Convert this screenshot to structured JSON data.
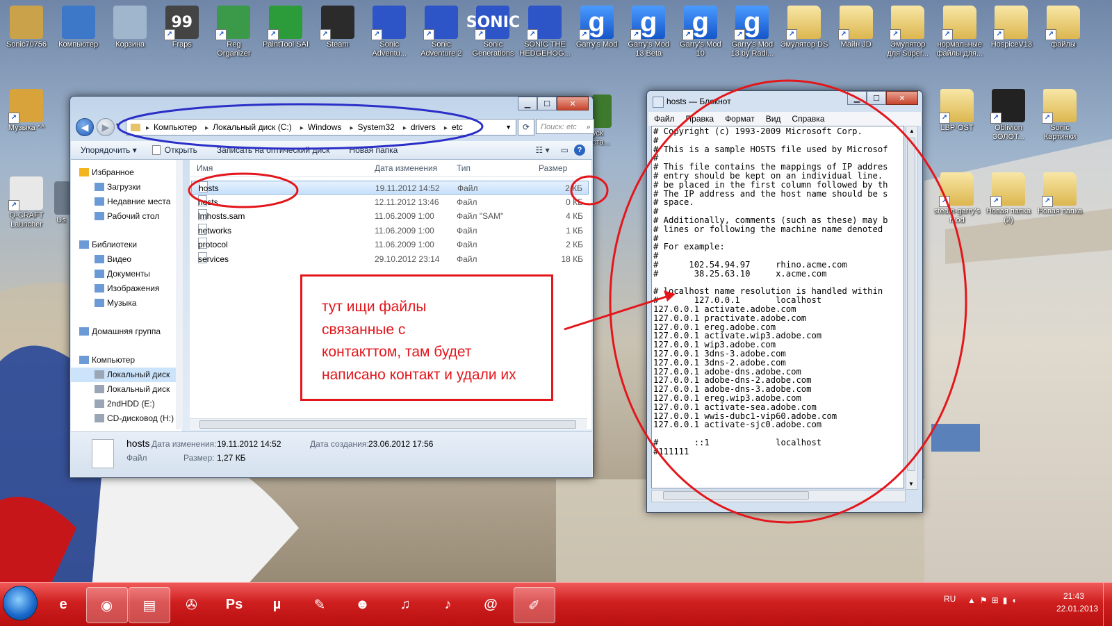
{
  "desktop": {
    "row1": [
      {
        "label": "Sonic70756",
        "icon": "user-icon"
      },
      {
        "label": "Компьютер",
        "icon": "computer-icon"
      },
      {
        "label": "Корзина",
        "icon": "recycle-bin-icon"
      },
      {
        "label": "Fraps",
        "icon": "fraps-icon",
        "badge": "99"
      },
      {
        "label": "Reg\nOrganizer",
        "icon": "reg-organizer-icon"
      },
      {
        "label": "PaintTool SAI",
        "icon": "painttool-icon"
      },
      {
        "label": "Steam",
        "icon": "steam-icon"
      },
      {
        "label": "Sonic\nAdventu...",
        "icon": "sonic-game-icon"
      },
      {
        "label": "Sonic\nAdventure 2",
        "icon": "sonic-game-icon"
      },
      {
        "label": "Sonic\nGenerations",
        "icon": "sonic-game-icon",
        "badge": "SONIC"
      },
      {
        "label": "SONIC THE\nHEDGEHOG...",
        "icon": "sonic-game-icon"
      },
      {
        "label": "Garry's Mod",
        "icon": "garrys-mod-icon",
        "badge": "g"
      },
      {
        "label": "Garry's Mod\n13 Beta",
        "icon": "garrys-mod-icon",
        "badge": "g"
      },
      {
        "label": "Garry's Mod\n10",
        "icon": "garrys-mod-icon",
        "badge": "g"
      },
      {
        "label": "Garry's Mod\n13 by Radi...",
        "icon": "garrys-mod-icon",
        "badge": "g"
      },
      {
        "label": "Эмулятор DS",
        "icon": "folder-icon"
      },
      {
        "label": "Майн JD",
        "icon": "folder-icon"
      },
      {
        "label": "Эмулятор\nдля Super...",
        "icon": "folder-icon"
      },
      {
        "label": "нормальные\nфайлы для...",
        "icon": "folder-icon"
      },
      {
        "label": "HospiceV13",
        "icon": "folder-icon"
      },
      {
        "label": "файлы",
        "icon": "folder-icon"
      }
    ],
    "left_col": [
      {
        "label": "Музыка ^^",
        "icon": "music-folder-icon"
      },
      {
        "label": "Q-CRAFT\nLauncher",
        "icon": "java-icon"
      }
    ],
    "right_col": [
      {
        "label": "LBP-OST",
        "icon": "folder-icon"
      },
      {
        "label": "Oblivion\nЗОЛОТ...",
        "icon": "oblivion-icon"
      },
      {
        "label": "Sonic\nКартинки",
        "icon": "folder-icon"
      },
      {
        "label": "steam-garry's\nmod",
        "icon": "folder-icon"
      },
      {
        "label": "Новая папка\n(2)",
        "icon": "folder-icon"
      },
      {
        "label": "Новая папка",
        "icon": "folder-icon"
      }
    ],
    "partial_labels": {
      "left": "Us",
      "explorer_right": "уск\nста..."
    }
  },
  "explorer": {
    "breadcrumbs": [
      "Компьютер",
      "Локальный диск (C:)",
      "Windows",
      "System32",
      "drivers",
      "etc"
    ],
    "search_placeholder": "Поиск: etc",
    "toolbar": [
      "Упорядочить ▾",
      "Открыть",
      "Записать на оптический диск",
      "Новая папка"
    ],
    "nav": [
      {
        "label": "Избранное",
        "level": 0,
        "icon": "star-icon"
      },
      {
        "label": "Загрузки",
        "level": 1,
        "icon": "downloads-icon"
      },
      {
        "label": "Недавние места",
        "level": 1,
        "icon": "recent-places-icon"
      },
      {
        "label": "Рабочий стол",
        "level": 1,
        "icon": "desktop-icon"
      },
      {
        "label": "",
        "level": -1
      },
      {
        "label": "Библиотеки",
        "level": 0,
        "icon": "libraries-icon"
      },
      {
        "label": "Видео",
        "level": 1,
        "icon": "video-icon"
      },
      {
        "label": "Документы",
        "level": 1,
        "icon": "documents-icon"
      },
      {
        "label": "Изображения",
        "level": 1,
        "icon": "pictures-icon"
      },
      {
        "label": "Музыка",
        "level": 1,
        "icon": "music-icon"
      },
      {
        "label": "",
        "level": -1
      },
      {
        "label": "Домашняя группа",
        "level": 0,
        "icon": "homegroup-icon"
      },
      {
        "label": "",
        "level": -1
      },
      {
        "label": "Компьютер",
        "level": 0,
        "icon": "computer-icon"
      },
      {
        "label": "Локальный диск",
        "level": 1,
        "icon": "drive-icon",
        "selected": true
      },
      {
        "label": "Локальный диск",
        "level": 1,
        "icon": "drive-icon"
      },
      {
        "label": "2ndHDD (E:)",
        "level": 1,
        "icon": "drive-icon"
      },
      {
        "label": "CD-дисковод (H:)",
        "level": 1,
        "icon": "cd-drive-icon"
      }
    ],
    "columns": [
      "Имя",
      "Дата изменения",
      "Тип",
      "Размер"
    ],
    "files": [
      {
        "name": "hosts",
        "modified": "19.11.2012 14:52",
        "type": "Файл",
        "size": "2 КБ",
        "selected": true
      },
      {
        "name": "hosts",
        "modified": "12.11.2012 13:46",
        "type": "Файл",
        "size": "0 КБ"
      },
      {
        "name": "lmhosts.sam",
        "modified": "11.06.2009 1:00",
        "type": "Файл \"SAM\"",
        "size": "4 КБ"
      },
      {
        "name": "networks",
        "modified": "11.06.2009 1:00",
        "type": "Файл",
        "size": "1 КБ"
      },
      {
        "name": "protocol",
        "modified": "11.06.2009 1:00",
        "type": "Файл",
        "size": "2 КБ"
      },
      {
        "name": "services",
        "modified": "29.10.2012 23:14",
        "type": "Файл",
        "size": "18 КБ"
      }
    ],
    "details": {
      "name": "hosts",
      "modified_label": "Дата изменения:",
      "modified": "19.11.2012 14:52",
      "created_label": "Дата создания:",
      "created": "23.06.2012 17:56",
      "type": "Файл",
      "size_label": "Размер:",
      "size": "1,27 КБ"
    }
  },
  "notepad": {
    "title": "hosts — Блокнот",
    "menu": [
      "Файл",
      "Правка",
      "Формат",
      "Вид",
      "Справка"
    ],
    "lines": [
      "# Copyright (c) 1993-2009 Microsoft Corp.",
      "#",
      "# This is a sample HOSTS file used by Microsof",
      "#",
      "# This file contains the mappings of IP addres",
      "# entry should be kept on an individual line.",
      "# be placed in the first column followed by th",
      "# The IP address and the host name should be s",
      "# space.",
      "#",
      "# Additionally, comments (such as these) may b",
      "# lines or following the machine name denoted",
      "#",
      "# For example:",
      "#",
      "#      102.54.94.97     rhino.acme.com",
      "#       38.25.63.10     x.acme.com",
      "",
      "# localhost name resolution is handled within",
      "#\t127.0.0.1       localhost",
      "127.0.0.1 activate.adobe.com",
      "127.0.0.1 practivate.adobe.com",
      "127.0.0.1 ereg.adobe.com",
      "127.0.0.1 activate.wip3.adobe.com",
      "127.0.0.1 wip3.adobe.com",
      "127.0.0.1 3dns-3.adobe.com",
      "127.0.0.1 3dns-2.adobe.com",
      "127.0.0.1 adobe-dns.adobe.com",
      "127.0.0.1 adobe-dns-2.adobe.com",
      "127.0.0.1 adobe-dns-3.adobe.com",
      "127.0.0.1 ereg.wip3.adobe.com",
      "127.0.0.1 activate-sea.adobe.com",
      "127.0.0.1 wwis-dubc1-vip60.adobe.com",
      "127.0.0.1 activate-sjc0.adobe.com",
      "",
      "#\t::1             localhost",
      "#111111"
    ]
  },
  "annotation": {
    "lines": [
      "тут ищи файлы",
      "связанные с",
      "контакттом, там будет",
      "написано контакт и удали их"
    ],
    "color": "#e3161b"
  },
  "taskbar": {
    "apps": [
      {
        "icon": "ie-icon",
        "glyph": "e"
      },
      {
        "icon": "chrome-icon",
        "glyph": "◉",
        "active": true
      },
      {
        "icon": "explorer-icon",
        "glyph": "▤",
        "active": true
      },
      {
        "icon": "media-icon",
        "glyph": "✇"
      },
      {
        "icon": "photoshop-icon",
        "glyph": "Ps"
      },
      {
        "icon": "utorrent-icon",
        "glyph": "µ"
      },
      {
        "icon": "paint-icon",
        "glyph": "✎"
      },
      {
        "icon": "icq-icon",
        "glyph": "☻"
      },
      {
        "icon": "itunes-icon",
        "glyph": "♫"
      },
      {
        "icon": "miku-icon",
        "glyph": "♪"
      },
      {
        "icon": "mail-agent-icon",
        "glyph": "@"
      },
      {
        "icon": "notepad-icon",
        "glyph": "✐",
        "active": true
      }
    ],
    "lang": "RU",
    "time": "21:43",
    "date": "22.01.2013"
  }
}
